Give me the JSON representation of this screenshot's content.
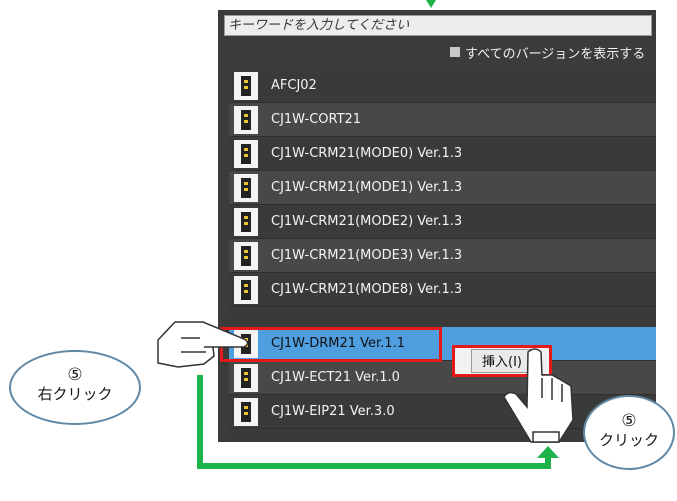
{
  "search": {
    "placeholder": "キーワードを入力してください"
  },
  "show_all_versions": {
    "label": "すべてのバージョンを表示する",
    "checked": false
  },
  "items": [
    {
      "label": "AFCJ02"
    },
    {
      "label": "CJ1W-CORT21"
    },
    {
      "label": "CJ1W-CRM21(MODE0) Ver.1.3"
    },
    {
      "label": "CJ1W-CRM21(MODE1) Ver.1.3"
    },
    {
      "label": "CJ1W-CRM21(MODE2) Ver.1.3"
    },
    {
      "label": "CJ1W-CRM21(MODE3) Ver.1.3"
    },
    {
      "label": "CJ1W-CRM21(MODE8) Ver.1.3"
    },
    {
      "label": "CJ1W-DRM21 Ver.1.1",
      "selected": true
    },
    {
      "label": "CJ1W-ECT21 Ver.1.0"
    },
    {
      "label": "CJ1W-EIP21 Ver.3.0"
    }
  ],
  "context_menu": {
    "insert_label": "挿入(I)"
  },
  "callouts": {
    "right_click": {
      "number": "⑤",
      "text": "右クリック"
    },
    "click": {
      "number": "⑤",
      "text": "クリック"
    }
  },
  "colors": {
    "highlight": "#e61919",
    "arrow": "#1db34a",
    "selection": "#4f9fe0",
    "callout_border": "#5f88a7"
  }
}
